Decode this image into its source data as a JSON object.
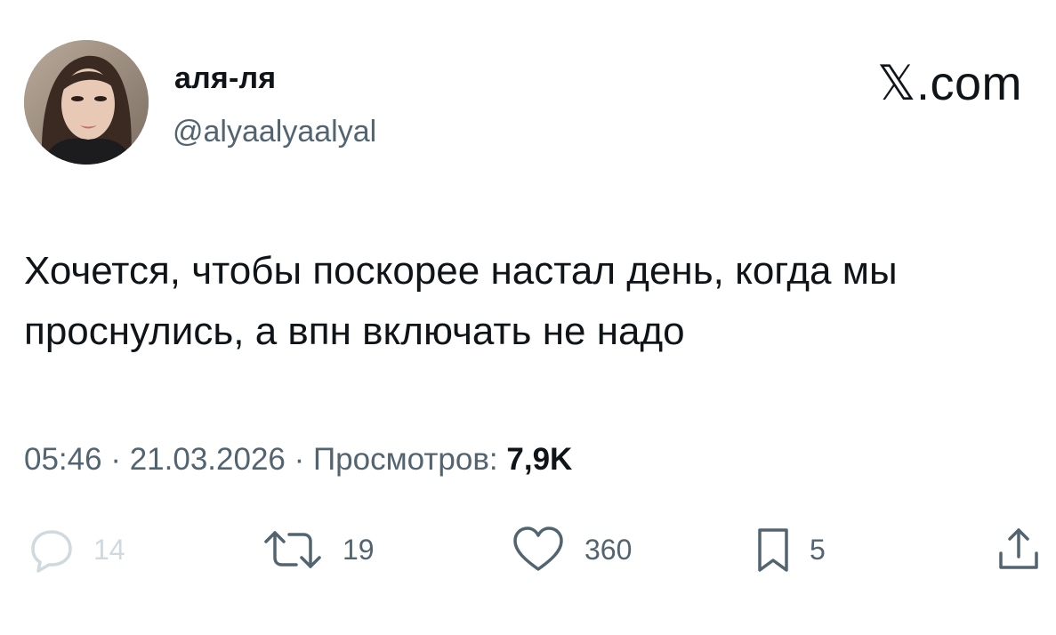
{
  "author": {
    "display_name": "аля-ля",
    "handle": "@alyaalyaalyal",
    "avatar_icon": "profile-photo"
  },
  "brand": {
    "label": "𝕏.com",
    "icon": "x-logo"
  },
  "tweet": {
    "text": "Хочется, чтобы поскорее настал день, когда мы проснулись, а впн включать не надо",
    "time": "05:46",
    "separator": "·",
    "date": "21.03.2026",
    "views_label": "Просмотров:",
    "views_count": "7,9K"
  },
  "actions": {
    "reply": {
      "icon": "reply-icon",
      "count": "14"
    },
    "retweet": {
      "icon": "retweet-icon",
      "count": "19"
    },
    "like": {
      "icon": "heart-icon",
      "count": "360"
    },
    "bookmark": {
      "icon": "bookmark-icon",
      "count": "5"
    },
    "share": {
      "icon": "share-icon"
    }
  },
  "colors": {
    "text": "#0f1419",
    "secondary": "#536471",
    "faded": "#cfd9de",
    "background": "#ffffff"
  }
}
